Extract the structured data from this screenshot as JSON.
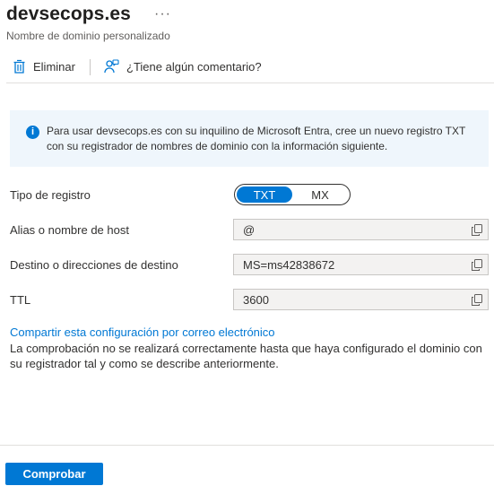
{
  "header": {
    "title": "devsecops.es",
    "more_label": "···",
    "subtitle": "Nombre de dominio personalizado"
  },
  "toolbar": {
    "delete_label": "Eliminar",
    "delete_icon": "trash-icon",
    "feedback_label": "¿Tiene algún comentario?",
    "feedback_icon": "feedback-person-icon"
  },
  "info": {
    "icon": "info-icon",
    "text": "Para usar devsecops.es con su inquilino de Microsoft Entra, cree un nuevo registro TXT con su registrador de nombres de dominio con la información siguiente."
  },
  "form": {
    "record_type": {
      "label": "Tipo de registro",
      "options": [
        "TXT",
        "MX"
      ],
      "selected": "TXT"
    },
    "alias": {
      "label": "Alias o nombre de host",
      "value": "@"
    },
    "destination": {
      "label": "Destino o direcciones de destino",
      "value": "MS=ms42838672"
    },
    "ttl": {
      "label": "TTL",
      "value": "3600"
    }
  },
  "share_link": "Compartir esta configuración por correo electrónico",
  "note": "La comprobación no se realizará correctamente hasta que haya configurado el dominio con su registrador tal y como se describe anteriormente.",
  "footer": {
    "verify_label": "Comprobar"
  },
  "colors": {
    "accent": "#0078d4",
    "info_bg": "#eff6fc",
    "field_bg": "#f3f2f1"
  }
}
